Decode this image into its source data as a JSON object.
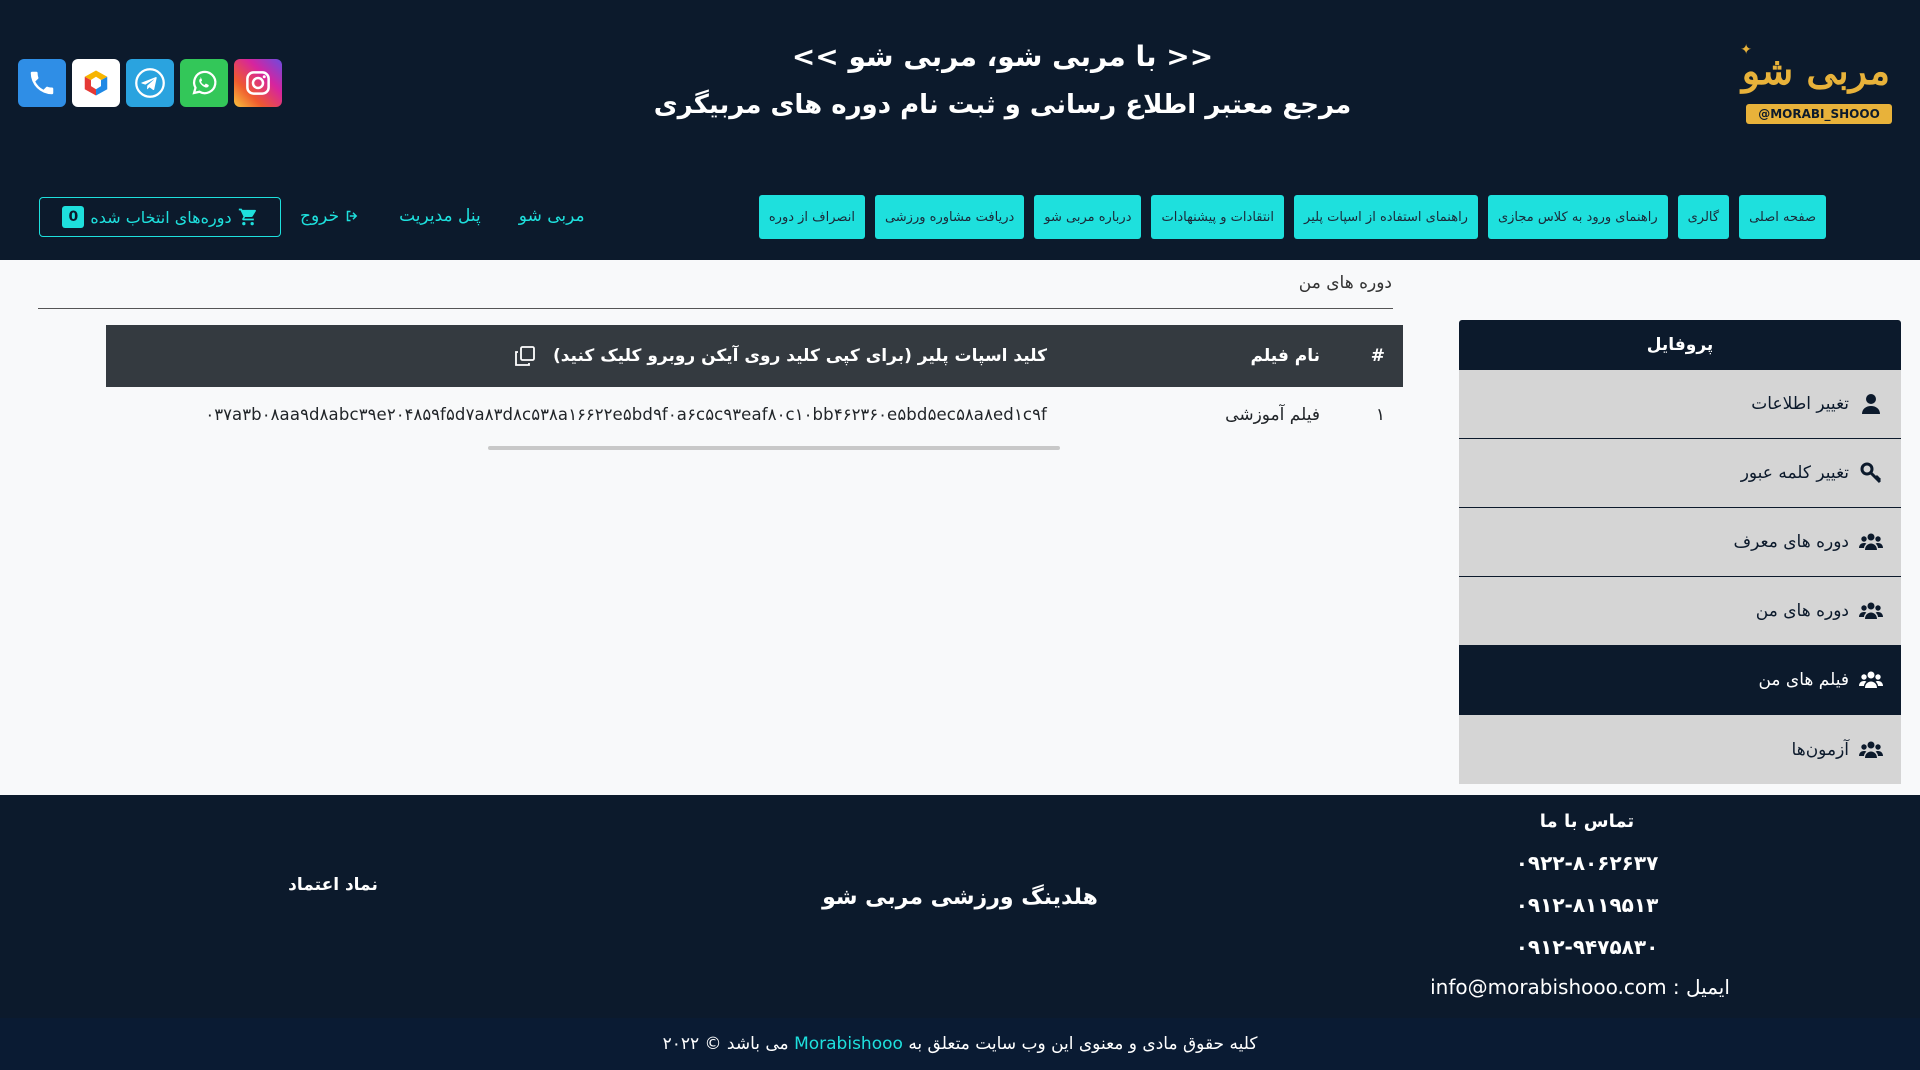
{
  "header": {
    "logo_text": "مربی شو",
    "logo_handle": "@MORABI_SHOOO",
    "slogan_line1": "<< با مربی شو، مربی شو >>",
    "slogan_line2": "مرجع معتبر اطلاع رسانی و ثبت نام دوره های مربیگری",
    "socials": [
      "phone-icon",
      "rubika-icon",
      "telegram-icon",
      "whatsapp-icon",
      "instagram-icon"
    ],
    "nav": [
      "صفحه اصلی",
      "گالری",
      "راهنمای ورود به کلاس مجازی",
      "راهنمای استفاده از اسپات پلیر",
      "انتقادات و پیشنهادات",
      "درباره مربی شو",
      "دریافت مشاوره ورزشی",
      "انصراف از دوره"
    ],
    "links": {
      "morabi": "مربی شو",
      "admin": "پنل مدیریت",
      "logout": "خروج"
    },
    "cart": {
      "label": "دوره‌های انتخاب شده",
      "count": "0"
    }
  },
  "sidebar": {
    "title": "پروفایل",
    "items": [
      {
        "label": "تغییر اطلاعات",
        "icon": "user-icon",
        "active": false
      },
      {
        "label": "تغییر کلمه عبور",
        "icon": "key-icon",
        "active": false
      },
      {
        "label": "دوره های معرف",
        "icon": "users-icon",
        "active": false
      },
      {
        "label": "دوره های من",
        "icon": "users-icon",
        "active": false
      },
      {
        "label": "فیلم های من",
        "icon": "users-icon",
        "active": true
      },
      {
        "label": "آزمون‌ها",
        "icon": "users-icon",
        "active": false
      }
    ]
  },
  "main": {
    "breadcrumb": "دوره های من",
    "table": {
      "headers": {
        "num": "#",
        "name": "نام فیلم",
        "key": "کلید اسپات پلیر (برای کپی کلید روی آیکن روبرو کلیک کنید)"
      },
      "rows": [
        {
          "num": "۱",
          "name": "فیلم آموزشی",
          "key": "۰۳۷a۳b۰۸aa۹d۸abc۳۹e۲۰۴۸۵۹f۵d۷a۸۳d۸c۵۳۸a۱۶۶۲۲e۵bd۹f۰a۶c۵c۹۳eaf۸۰c۱۰bb۴۶۲۳۶۰e۵bd۵ec۵۸a۸ed۱c۹f"
        }
      ]
    }
  },
  "footer": {
    "contact_title": "تماس با ما",
    "phones": [
      "۰۹۲۲-۸۰۶۲۶۳۷",
      "۰۹۱۲-۸۱۱۹۵۱۳",
      "۰۹۱۲-۹۴۷۵۸۳۰"
    ],
    "email": "ایمیل : info@morabishooo.com",
    "brand": "هلدینگ ورزشی مربی شو",
    "trust": "نماد اعتماد",
    "copyright_pre": "کلیه حقوق مادی و معنوی این وب سایت متعلق به",
    "copyright_site": "Morabishooo",
    "copyright_post": "می باشد © ۲۰۲۲"
  },
  "colors": {
    "navy": "#0c1a2c",
    "accent": "#1ee0dd",
    "table_head": "#343a40",
    "sidebar_item": "#d5d5d5"
  }
}
